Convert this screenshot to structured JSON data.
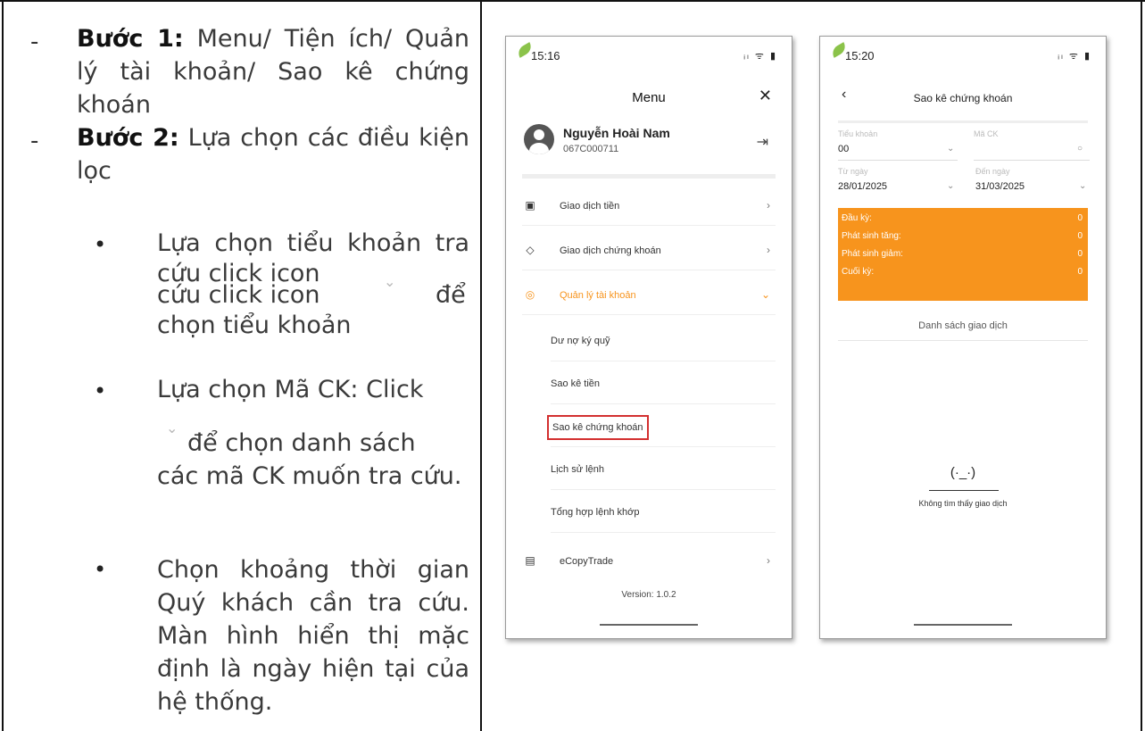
{
  "left": {
    "step1": {
      "bold": "Bước 1:",
      "text": " Menu/ Tiện ích/ Quản lý tài khoản/ Sao kê chứng khoán"
    },
    "step2": {
      "bold": "Bước 2:",
      "text": " Lựa chọn các điều kiện lọc"
    },
    "dash": "-",
    "bullet_symbol": "•",
    "chevron_glyph": "⌄",
    "bullet1": {
      "before": "Lựa chọn tiểu khoản tra cứu click icon",
      "after": "để chọn tiểu khoản"
    },
    "bullet2": {
      "before": "Lựa chọn Mã CK: Click",
      "after": "để chọn danh sách các mã CK muốn tra cứu."
    },
    "bullet3": "Chọn khoảng thời gian Quý khách cần tra cứu. Màn hình hiển thị mặc định là ngày hiện tại của hệ thống."
  },
  "phone1": {
    "time": "15:16",
    "status_icons": "ᵢₗ ᯤ ▮",
    "title": "Menu",
    "close": "✕",
    "user": {
      "name": "Nguyễn Hoài Nam",
      "account": "067C000711"
    },
    "logout_icon": "⇥",
    "items": [
      {
        "label": "Giao dịch tiền",
        "icon": "wallet-icon",
        "glyph": "▣",
        "chevron": "›"
      },
      {
        "label": "Giao dịch chứng khoán",
        "icon": "tag-icon",
        "glyph": "◇",
        "chevron": "›"
      },
      {
        "label": "Quản lý tài khoản",
        "icon": "account-icon",
        "glyph": "◎",
        "chevron": "⌄"
      }
    ],
    "sub_items": [
      "Dư nợ ký quỹ",
      "Sao kê tiền",
      "Sao kê chứng khoán",
      "Lịch sử lệnh",
      "Tổng hợp lệnh khớp"
    ],
    "ecopy": {
      "label": "eCopyTrade",
      "glyph": "▤",
      "chevron": "›"
    },
    "version": "Version: 1.0.2",
    "active_color": "#f7941d",
    "highlight_color": "#d32f2f"
  },
  "phone2": {
    "time": "15:20",
    "status_icons": "ᵢₗ ᯤ ▮",
    "back": "‹",
    "title": "Sao kê chứng khoán",
    "filters": {
      "sub_account_label": "Tiểu khoản",
      "sub_account_value": "00",
      "symbol_label": "Mã CK",
      "from_label": "Từ ngày",
      "from_value": "28/01/2025",
      "to_label": "Đến ngày",
      "to_value": "31/03/2025",
      "chevron": "⌄",
      "search_glyph": "○"
    },
    "summary": [
      {
        "label": "Đầu kỳ:",
        "value": "0"
      },
      {
        "label": "Phát sinh tăng:",
        "value": "0"
      },
      {
        "label": "Phát sinh giảm:",
        "value": "0"
      },
      {
        "label": "Cuối kỳ:",
        "value": "0"
      }
    ],
    "list_title": "Danh sách giao dịch",
    "empty_face": "(·_·)",
    "empty_text": "Không tìm thấy giao dịch",
    "accent_color": "#f7941d"
  }
}
